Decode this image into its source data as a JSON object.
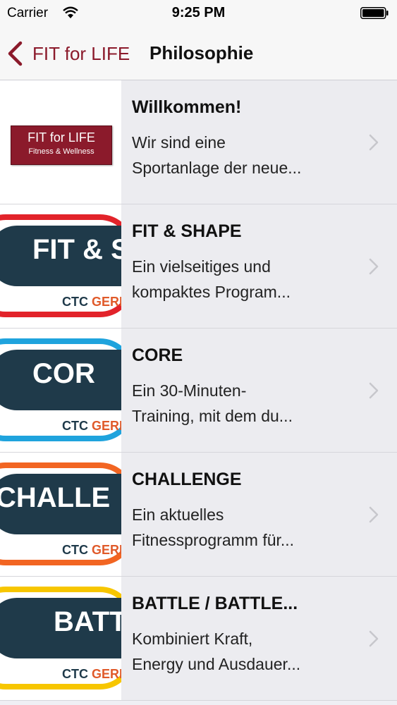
{
  "status_bar": {
    "carrier": "Carrier",
    "time": "9:25 PM"
  },
  "nav": {
    "back_label": "FIT for LIFE",
    "title": "Philosophie"
  },
  "logo": {
    "line1": "FIT for LIFE",
    "line2": "Fitness & Wellness"
  },
  "items": [
    {
      "title": "Willkommen!",
      "desc_line1": "Wir sind eine",
      "desc_line2": "Sportanlage der neue..."
    },
    {
      "title": "FIT & SHAPE",
      "badge_text": "FIT & SI",
      "badge_ctc_1": "CTC",
      "badge_ctc_2": "GERM",
      "desc_line1": "Ein vielseitiges und",
      "desc_line2": "kompaktes Program..."
    },
    {
      "title": "CORE",
      "badge_text": "COR",
      "badge_ctc_1": "CTC",
      "badge_ctc_2": "GERM",
      "desc_line1": "Ein 30-Minuten-",
      "desc_line2": "Training, mit dem du..."
    },
    {
      "title": "CHALLENGE",
      "badge_text": "CHALLE",
      "badge_ctc_1": "CTC",
      "badge_ctc_2": "GERM",
      "desc_line1": "Ein aktuelles",
      "desc_line2": "Fitnessprogramm für..."
    },
    {
      "title": "BATTLE / BATTLE...",
      "badge_text": "BATT",
      "badge_ctc_1": "CTC",
      "badge_ctc_2": "GERM",
      "desc_line1": "Kombiniert Kraft,",
      "desc_line2": "Energy und Ausdauer..."
    }
  ],
  "colors": {
    "accent": "#8b1a2b",
    "badge_fit_shape": "#e2232a",
    "badge_core": "#1fa3dd",
    "badge_challenge": "#f26522",
    "badge_battle": "#f7c600"
  }
}
